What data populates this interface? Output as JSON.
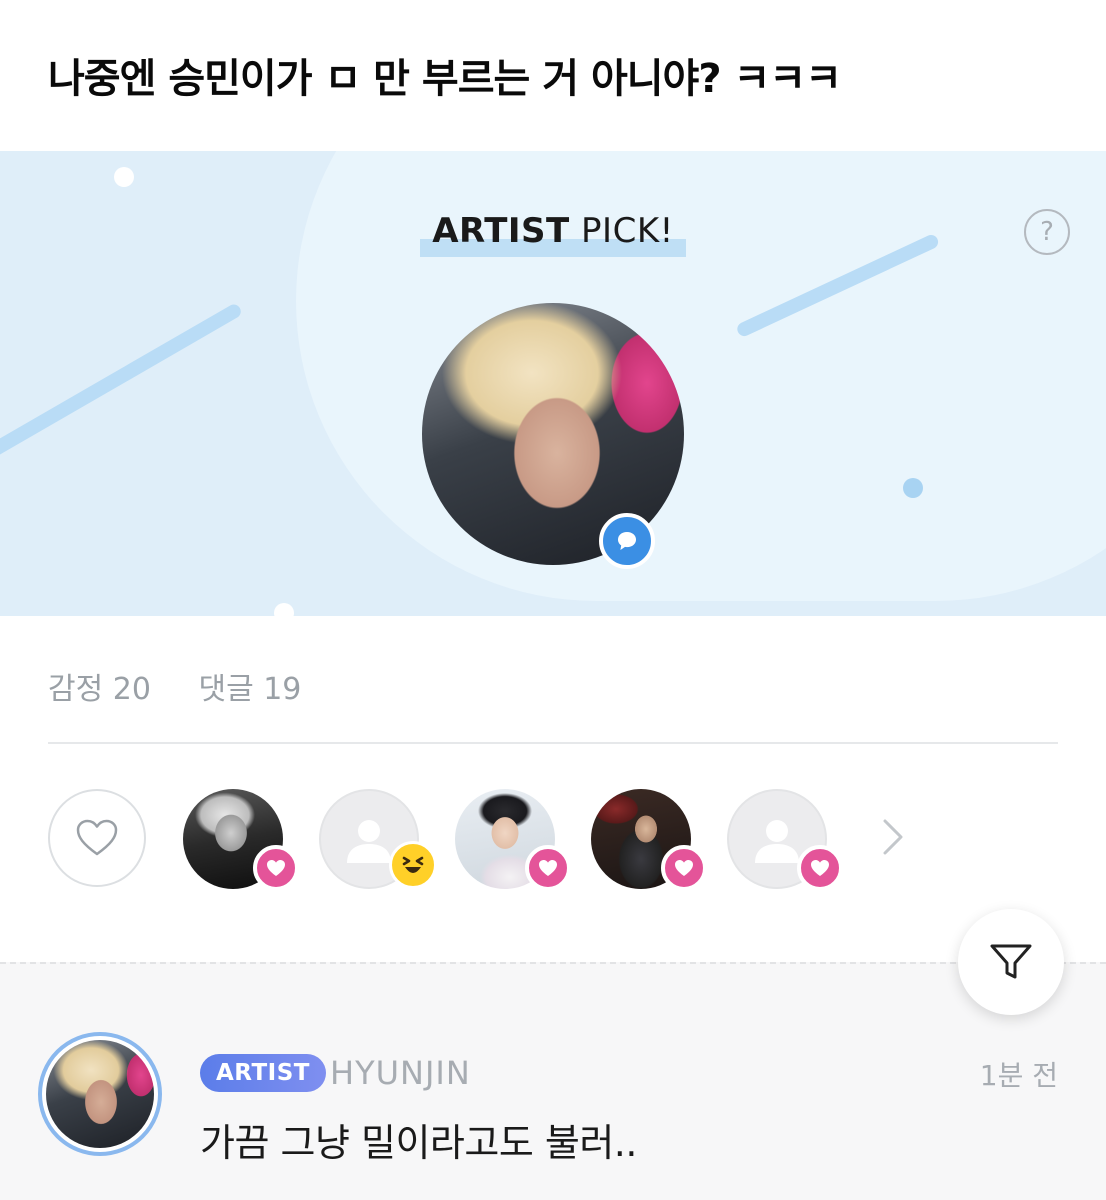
{
  "post": {
    "title": "나중엔 승민이가 ㅁ 만 부르는 거 아니야? ㅋㅋㅋ"
  },
  "artist_pick": {
    "title_bold": "ARTIST",
    "title_rest": " PICK!",
    "help_glyph": "?",
    "badge_icon": "chat-bubble-icon"
  },
  "stats": {
    "emotion_label": "감정 20",
    "comment_label": "댓글 19"
  },
  "reactions": {
    "like_icon": "heart-outline-icon",
    "reactors": [
      {
        "avatar": "photo",
        "reaction": "heart"
      },
      {
        "avatar": "default",
        "reaction": "laugh"
      },
      {
        "avatar": "photo",
        "reaction": "heart"
      },
      {
        "avatar": "photo",
        "reaction": "heart"
      },
      {
        "avatar": "default",
        "reaction": "heart"
      }
    ],
    "more_icon": "chevron-right-icon"
  },
  "filter": {
    "icon": "filter-funnel-icon"
  },
  "comment": {
    "badge": "ARTIST",
    "author": "HYUNJIN",
    "time": "1분 전",
    "text": "가끔 그냥 밀이라고도 불러.."
  },
  "colors": {
    "banner_bg": "#dfeef9",
    "highlight": "#bfdff5",
    "reaction_heart": "#e45499",
    "pick_badge": "#3b8fe4",
    "artist_badge": "#5b7de9"
  }
}
